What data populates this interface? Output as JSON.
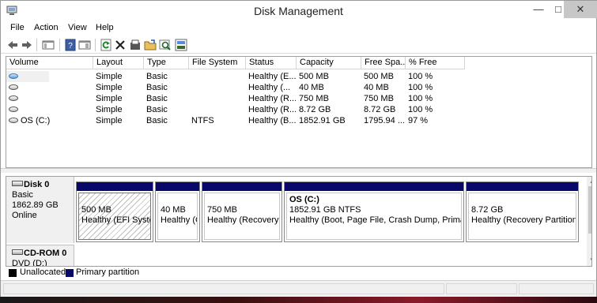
{
  "window": {
    "title": "Disk Management"
  },
  "menu": [
    "File",
    "Action",
    "View",
    "Help"
  ],
  "toolbar": [
    "back-icon",
    "forward-icon",
    "console-tree-icon",
    "help-icon",
    "properties-icon",
    "refresh-icon",
    "delete-icon",
    "open-icon",
    "explore-icon",
    "find-icon",
    "rescan-icon"
  ],
  "columns": [
    "Volume",
    "Layout",
    "Type",
    "File System",
    "Status",
    "Capacity",
    "Free Spa...",
    "% Free"
  ],
  "volumes": [
    {
      "volume": "",
      "layout": "Simple",
      "type": "Basic",
      "fs": "",
      "status": "Healthy (E...",
      "capacity": "500 MB",
      "free": "500 MB",
      "pct": "100 %"
    },
    {
      "volume": "",
      "layout": "Simple",
      "type": "Basic",
      "fs": "",
      "status": "Healthy (...",
      "capacity": "40 MB",
      "free": "40 MB",
      "pct": "100 %"
    },
    {
      "volume": "",
      "layout": "Simple",
      "type": "Basic",
      "fs": "",
      "status": "Healthy (R...",
      "capacity": "750 MB",
      "free": "750 MB",
      "pct": "100 %"
    },
    {
      "volume": "",
      "layout": "Simple",
      "type": "Basic",
      "fs": "",
      "status": "Healthy (R...",
      "capacity": "8.72 GB",
      "free": "8.72 GB",
      "pct": "100 %"
    },
    {
      "volume": "OS (C:)",
      "layout": "Simple",
      "type": "Basic",
      "fs": "NTFS",
      "status": "Healthy (B...",
      "capacity": "1852.91 GB",
      "free": "1795.94 ...",
      "pct": "97 %"
    }
  ],
  "disk0": {
    "name": "Disk 0",
    "type": "Basic",
    "size": "1862.89 GB",
    "state": "Online",
    "partitions": [
      {
        "title": "",
        "size": "500 MB",
        "status": "Healthy (EFI System"
      },
      {
        "title": "",
        "size": "40 MB",
        "status": "Healthy (C"
      },
      {
        "title": "",
        "size": "750 MB",
        "status": "Healthy (Recovery Pa"
      },
      {
        "title": "OS  (C:)",
        "size": "1852.91 GB NTFS",
        "status": "Healthy (Boot, Page File, Crash Dump, Primary P"
      },
      {
        "title": "",
        "size": "8.72 GB",
        "status": "Healthy (Recovery Partition)"
      }
    ]
  },
  "cdrom0": {
    "name": "CD-ROM 0",
    "type": "DVD (D:)"
  },
  "legend": [
    {
      "label": "Unallocated",
      "color": "#000000"
    },
    {
      "label": "Primary partition",
      "color": "#08086b"
    }
  ]
}
